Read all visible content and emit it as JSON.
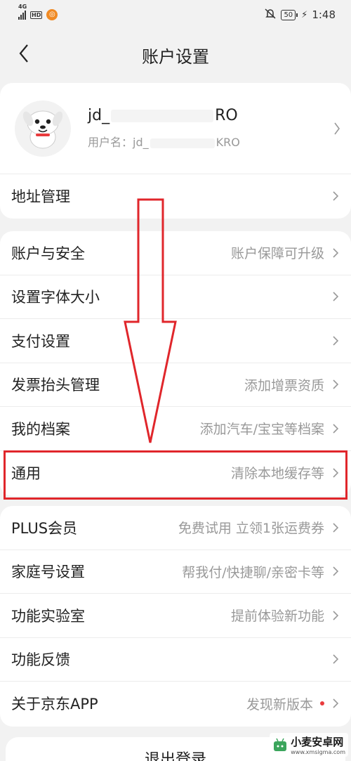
{
  "status_bar": {
    "network": "4G",
    "hd": "HD",
    "battery": "50",
    "time": "1:48"
  },
  "nav": {
    "title": "账户设置"
  },
  "profile": {
    "name": "jd_",
    "name_suffix": "RO",
    "id_label": "用户名：jd_",
    "id_suffix": "KRO"
  },
  "address": {
    "label": "地址管理"
  },
  "settings": [
    {
      "label": "账户与安全",
      "value": "账户保障可升级"
    },
    {
      "label": "设置字体大小",
      "value": ""
    },
    {
      "label": "支付设置",
      "value": ""
    },
    {
      "label": "发票抬头管理",
      "value": "添加增票资质"
    },
    {
      "label": "我的档案",
      "value": "添加汽车/宝宝等档案"
    },
    {
      "label": "通用",
      "value": "清除本地缓存等"
    }
  ],
  "more": [
    {
      "label": "PLUS会员",
      "value": "免费试用 立领1张运费券"
    },
    {
      "label": "家庭号设置",
      "value": "帮我付/快捷聊/亲密卡等"
    },
    {
      "label": "功能实验室",
      "value": "提前体验新功能"
    },
    {
      "label": "功能反馈",
      "value": ""
    },
    {
      "label": "关于京东APP",
      "value": "发现新版本"
    }
  ],
  "logout": {
    "label": "退出登录"
  },
  "watermark": {
    "name": "小麦安卓网",
    "url": "www.xmsigma.com"
  },
  "colors": {
    "accent_red": "#e0262b",
    "badge_red": "#e93b3d"
  }
}
